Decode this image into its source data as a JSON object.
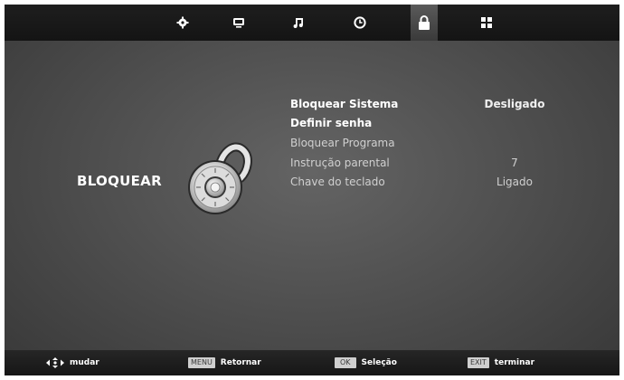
{
  "top_menu": {
    "items": [
      {
        "icon": "gear-icon",
        "active": false
      },
      {
        "icon": "tv-screen-icon",
        "active": false
      },
      {
        "icon": "music-note-icon",
        "active": false
      },
      {
        "icon": "clock-icon",
        "active": false
      },
      {
        "icon": "lock-icon",
        "active": true
      },
      {
        "icon": "grid-icon",
        "active": false
      }
    ]
  },
  "page": {
    "title": "BLOQUEAR",
    "graphic": "combination-lock-icon"
  },
  "settings": [
    {
      "label": "Bloquear Sistema",
      "value": "Desligado"
    },
    {
      "label": "Definir senha",
      "value": ""
    },
    {
      "label": "Bloquear Programa",
      "value": ""
    },
    {
      "label": "Instrução parental",
      "value": "7"
    },
    {
      "label": "Chave do teclado",
      "value": "Ligado"
    }
  ],
  "footer": {
    "move": {
      "icon": "directional-arrows-icon",
      "text": "mudar"
    },
    "back": {
      "key": "MENU",
      "text": "Retornar"
    },
    "select": {
      "key": "OK",
      "text": "Seleção"
    },
    "exit": {
      "key": "EXIT",
      "text": "terminar"
    }
  },
  "colors": {
    "background": "#4c4c4c",
    "bars": "#161616",
    "text": "#ffffff"
  }
}
